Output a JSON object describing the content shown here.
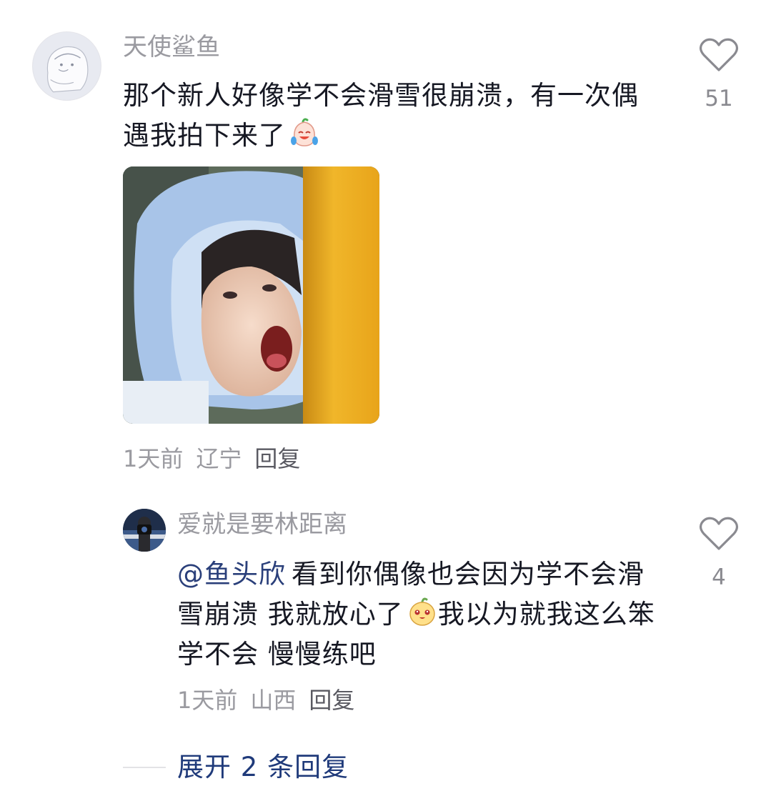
{
  "comment": {
    "username": "天使鲨鱼",
    "text": "那个新人好像学不会滑雪很崩溃，有一次偶遇我拍下来了",
    "emoji": "crying-laughing-peach-emoji",
    "time": "1天前",
    "location": "辽宁",
    "reply_label": "回复",
    "likes": "51"
  },
  "reply": {
    "username": "爱就是要林距离",
    "mention": "@鱼头欣",
    "text_part1": "看到你偶像也会因为学不会滑雪崩溃 我就放心了",
    "emoji": "smiling-mango-emoji",
    "text_part2": "我以为就我这么笨学不会 慢慢练吧",
    "time": "1天前",
    "location": "山西",
    "reply_label": "回复",
    "likes": "4"
  },
  "expand_label": "展开 2 条回复",
  "colors": {
    "text": "#161823",
    "secondary": "#9a9aa0",
    "link": "#1f3a7a"
  }
}
